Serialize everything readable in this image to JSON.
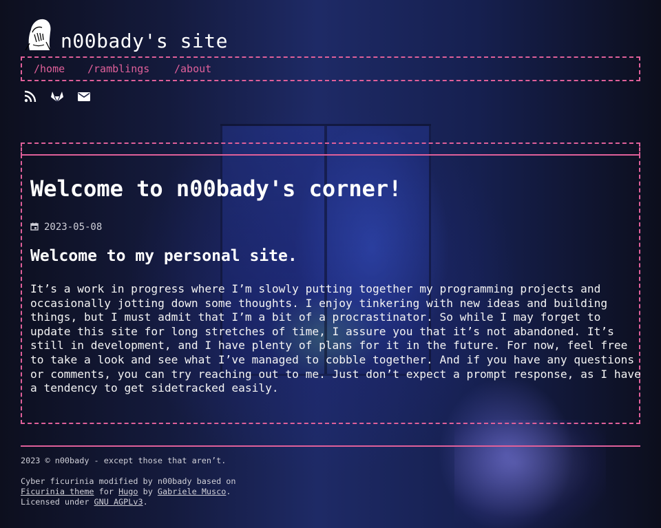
{
  "header": {
    "site_title": "n00bady's site",
    "logo_icon": "facepalm-avatar-icon"
  },
  "nav": {
    "items": [
      {
        "label": "/home"
      },
      {
        "label": "/ramblings"
      },
      {
        "label": "/about"
      }
    ]
  },
  "social": {
    "items": [
      {
        "icon": "rss-icon"
      },
      {
        "icon": "gitlab-icon"
      },
      {
        "icon": "mail-icon"
      }
    ]
  },
  "post": {
    "title": "Welcome to n00bady's corner!",
    "date": "2023-05-08",
    "subtitle": "Welcome to my personal site.",
    "body": "It’s a work in progress where I’m slowly putting together my programming projects and\noccasionally jotting down some thoughts. I enjoy tinkering with new ideas and building\nthings, but I must admit that I’m a bit of a procrastinator. So while I may forget to\nupdate this site for long stretches of time, I assure you that it’s not abandoned. It’s\nstill in development, and I have plenty of plans for it in the future. For now, feel free\nto take a look and see what I’ve managed to cobble together. And if you have any questions\nor comments, you can try reaching out to me. Just don’t expect a prompt response, as I have\na tendency to get sidetracked easily."
  },
  "footer": {
    "copyright": "2023 © n00bady - except those that aren’t.",
    "credit_prefix": "Cyber ficurinia modified by n00bady based on",
    "theme_link": "Ficurinia theme",
    "for_text": " for ",
    "hugo_link": "Hugo",
    "by_text": " by ",
    "author_link": "Gabriele Musco",
    "period": ".",
    "license_prefix": "Licensed under ",
    "license_link": "GNU AGPLv3",
    "license_suffix": "."
  },
  "colors": {
    "accent": "#e0609a",
    "text": "#ffffff"
  }
}
